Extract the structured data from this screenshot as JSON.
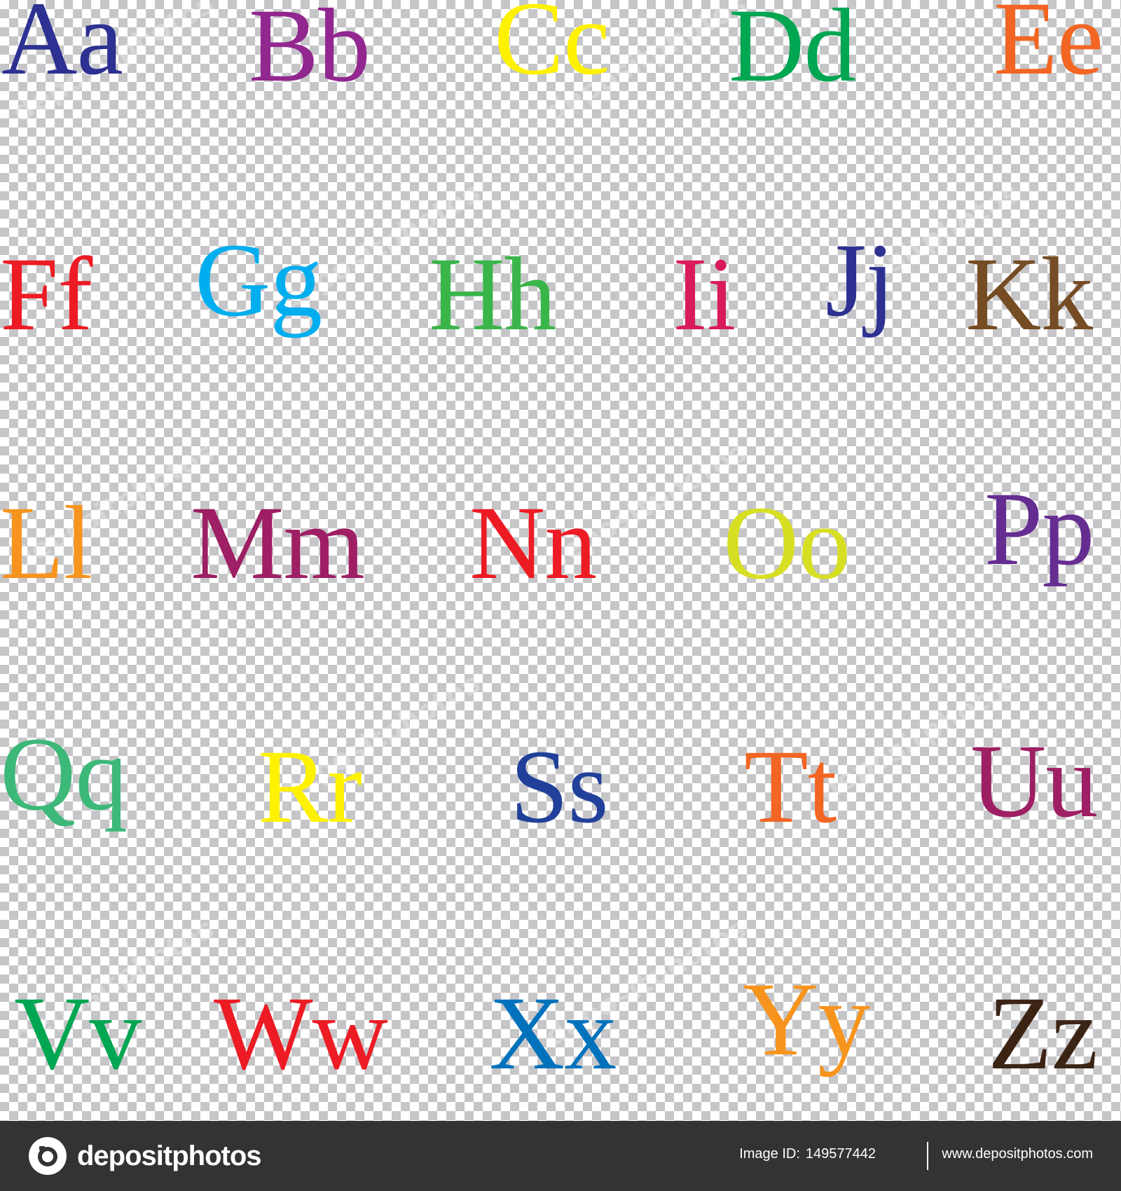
{
  "letters": [
    {
      "text": "Aa",
      "color": "#2d3192"
    },
    {
      "text": "Bb",
      "color": "#92278f"
    },
    {
      "text": "Cc",
      "color": "#fff200"
    },
    {
      "text": "Dd",
      "color": "#00a651"
    },
    {
      "text": "Ee",
      "color": "#f26522"
    },
    {
      "text": "Ff",
      "color": "#ed1c24"
    },
    {
      "text": "Gg",
      "color": "#00aeef"
    },
    {
      "text": "Hh",
      "color": "#39b54a"
    },
    {
      "text": "Ii",
      "color": "#d91b5c"
    },
    {
      "text": "Jj",
      "color": "#2e3192"
    },
    {
      "text": "Kk",
      "color": "#754c24"
    },
    {
      "text": "Ll",
      "color": "#f7941d"
    },
    {
      "text": "Mm",
      "color": "#9e1f63"
    },
    {
      "text": "Nn",
      "color": "#ed1c24"
    },
    {
      "text": "Oo",
      "color": "#d7df23"
    },
    {
      "text": "Pp",
      "color": "#662d91"
    },
    {
      "text": "Qq",
      "color": "#3cb878"
    },
    {
      "text": "Rr",
      "color": "#fff200"
    },
    {
      "text": "Ss",
      "color": "#21409a"
    },
    {
      "text": "Tt",
      "color": "#f26522"
    },
    {
      "text": "Uu",
      "color": "#9e1f63"
    },
    {
      "text": "Vv",
      "color": "#00a651"
    },
    {
      "text": "Ww",
      "color": "#ed1c24"
    },
    {
      "text": "Xx",
      "color": "#0072bc"
    },
    {
      "text": "Yy",
      "color": "#f7941d"
    },
    {
      "text": "Zz",
      "color": "#3c2415"
    }
  ],
  "watermark": {
    "text": "depositphotos"
  },
  "footer": {
    "brand": "depositphotos",
    "image_id_label": "Image ID:",
    "image_id": "149577442",
    "site": "www.depositphotos.com"
  }
}
